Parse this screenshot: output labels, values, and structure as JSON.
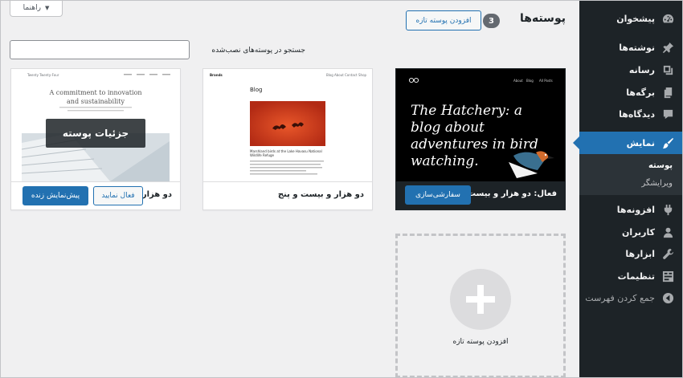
{
  "sidebar": {
    "items": [
      {
        "key": "dashboard",
        "label": "پیشخوان"
      },
      {
        "key": "posts",
        "label": "نوشته‌ها"
      },
      {
        "key": "media",
        "label": "رسانه"
      },
      {
        "key": "pages",
        "label": "برگه‌ها"
      },
      {
        "key": "comments",
        "label": "دیدگاه‌ها"
      },
      {
        "key": "appearance",
        "label": "نمایش"
      },
      {
        "key": "plugins",
        "label": "افزونه‌ها"
      },
      {
        "key": "users",
        "label": "کاربران"
      },
      {
        "key": "tools",
        "label": "ابزارها"
      },
      {
        "key": "settings",
        "label": "تنظیمات"
      },
      {
        "key": "collapse",
        "label": "جمع کردن فهرست"
      }
    ],
    "submenu": [
      {
        "label": "پوسته"
      },
      {
        "label": "ویرایشگر"
      }
    ]
  },
  "header": {
    "help": "راهنما",
    "title": "پوسته‌ها",
    "count": "3",
    "add_new": "افزودن پوسته تازه"
  },
  "search": {
    "label": "جستجو در پوسته‌های نصب‌شده",
    "value": ""
  },
  "themes": [
    {
      "name": "فعال: دو هزار و بیست و",
      "button": "سفارشی‌سازی",
      "screenshot": {
        "nav": [
          "About",
          "Blog",
          "All Posts"
        ],
        "headline": "The Hatchery: a blog about adventures in bird watching."
      }
    },
    {
      "name": "دو هزار و بیست و پنج",
      "screenshot": {
        "brand": "Brands",
        "nav": [
          "Blog",
          "About",
          "Contact",
          "Shop"
        ],
        "heading": "Blog",
        "caption": "Marshland birds at the Lake Havasu National Wildlife Refuge"
      }
    },
    {
      "name": "دو هزار و",
      "overlay": "جزئیات پوسته",
      "activate": "فعال نمایید",
      "preview": "پیش‌نمایش زنده",
      "screenshot": {
        "brand": "Twenty Twenty-Four",
        "headline": "A commitment to innovation and sustainability"
      }
    }
  ],
  "add_tile": {
    "label": "افزودن پوسته تازه"
  },
  "colors": {
    "sidebar_bg": "#1d2327",
    "accent": "#2271b1",
    "page_bg": "#f0f0f1"
  }
}
